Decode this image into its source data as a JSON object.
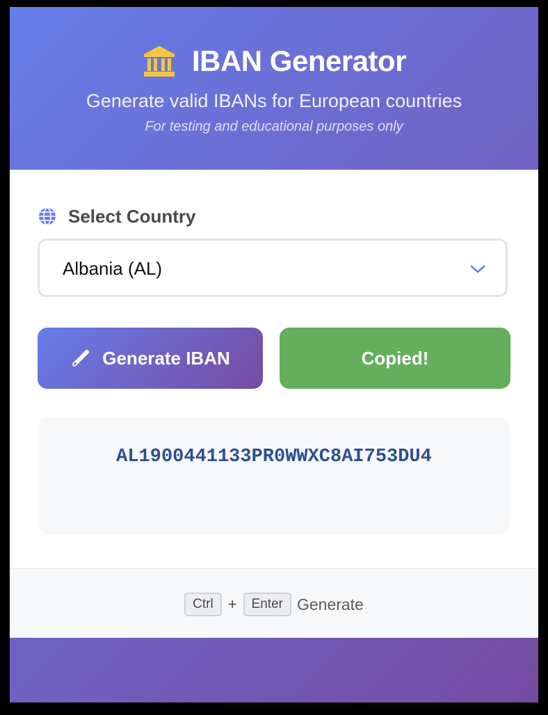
{
  "header": {
    "icon": "bank-icon",
    "title": "IBAN Generator",
    "subtitle": "Generate valid IBANs for European countries",
    "note": "For testing and educational purposes only"
  },
  "form": {
    "label_icon": "globe-icon",
    "label": "Select Country",
    "selected_country": "Albania (AL)",
    "dropdown_icon": "chevron-down-icon"
  },
  "buttons": {
    "generate_icon": "pencil-icon",
    "generate_label": "Generate IBAN",
    "copy_label": "Copied!"
  },
  "result": {
    "iban": "AL1900441133PR0WWXC8AI753DU4"
  },
  "footer": {
    "key1": "Ctrl",
    "plus": "+",
    "key2": "Enter",
    "action": "Generate"
  },
  "colors": {
    "gradient_start": "#667eea",
    "gradient_end": "#764ba2",
    "copied_green": "#65ae5b",
    "iban_blue": "#2d5091",
    "icon_gold": "#f5c542"
  }
}
